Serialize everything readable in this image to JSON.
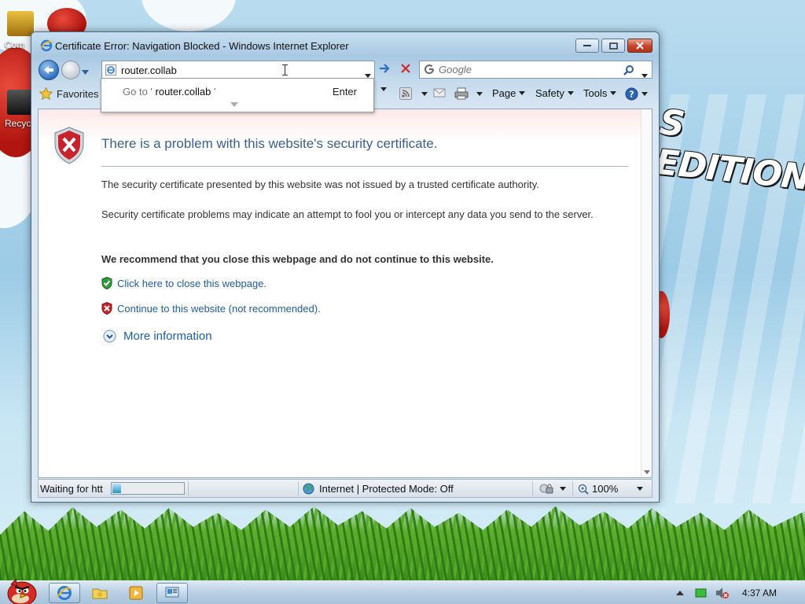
{
  "desktop": {
    "icons": [
      {
        "label": "Com"
      },
      {
        "label": "Recyc"
      }
    ],
    "wallpaper_text": "S EDITION"
  },
  "window": {
    "title": "Certificate Error: Navigation Blocked - Windows Internet Explorer"
  },
  "nav": {
    "address_value": "router.collab",
    "search_placeholder": "Google"
  },
  "autocomplete": {
    "go_prefix": "Go to '",
    "go_target": "router.collab",
    "go_suffix": "'",
    "enter": "Enter"
  },
  "command_bar": {
    "favorites": "Favorites",
    "page": "Page",
    "safety": "Safety",
    "tools": "Tools"
  },
  "content": {
    "title": "There is a problem with this website's security certificate.",
    "p1": "The security certificate presented by this website was not issued by a trusted certificate authority.",
    "p2": "Security certificate problems may indicate an attempt to fool you or intercept any data you send to the server.",
    "recommend": "We recommend that you close this webpage and do not continue to this website.",
    "close_link": "Click here to close this webpage.",
    "continue_link": "Continue to this website (not recommended).",
    "more_info": "More information"
  },
  "status": {
    "text": "Waiting for htt",
    "progress": 0.12,
    "zone": "Internet | Protected Mode: Off",
    "zoom": "100%"
  },
  "taskbar": {
    "clock": "4:37 AM"
  },
  "colors": {
    "link": "#1f5d9c",
    "title": "#3d5f8a",
    "error_red": "#c8232b",
    "ok_green": "#2e9b3a"
  }
}
